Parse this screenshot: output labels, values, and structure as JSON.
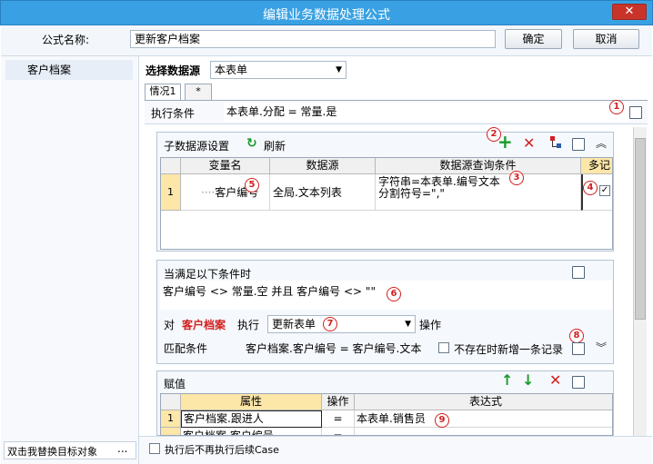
{
  "window": {
    "title": "编辑业务数据处理公式",
    "close_symbol": "✕"
  },
  "formula": {
    "name_label": "公式名称:",
    "name_value": "更新客户档案",
    "ok": "确定",
    "cancel": "取消"
  },
  "sidebar": {
    "items": [
      {
        "label": "客户档案"
      }
    ],
    "footer": "双击我替换目标对象",
    "more": "..."
  },
  "datasource": {
    "label": "选择数据源",
    "value": "本表单"
  },
  "tabs": [
    {
      "label": "情况1"
    },
    {
      "label": "*"
    }
  ],
  "condition": {
    "label": "执行条件",
    "value": "本表单.分配 = 常量.是"
  },
  "subsource": {
    "title": "子数据源设置",
    "refresh": "刷新",
    "columns": [
      "变量名",
      "数据源",
      "数据源查询条件",
      "多记"
    ],
    "rows": [
      {
        "num": "1",
        "var": "客户编号",
        "source": "全局.文本列表",
        "query": [
          "字符串=本表单.编号文本",
          "分割符号=\",\""
        ],
        "multi": true
      }
    ]
  },
  "when": {
    "title": "当满足以下条件时",
    "expr": "客户编号 <> 常量.空 并且 客户编号 <> \"\"",
    "to": "对",
    "target": "客户档案",
    "exec": "执行",
    "action": "更新表单",
    "op": "操作",
    "match_label": "匹配条件",
    "match_expr": "客户档案.客户编号 = 客户编号.文本",
    "no_exist": "不存在时新增一条记录"
  },
  "assign": {
    "title": "赋值",
    "columns": [
      "属性",
      "操作",
      "表达式"
    ],
    "rows": [
      {
        "num": "1",
        "prop": "客户档案.跟进人",
        "op": "=",
        "expr": "本表单.销售员"
      },
      {
        "num": "",
        "prop": "客户档案.客户编号",
        "op": "=",
        "expr": ""
      }
    ]
  },
  "footer": {
    "no_continue": "执行后不再执行后续Case"
  },
  "markers": [
    "1",
    "2",
    "3",
    "4",
    "5",
    "6",
    "7",
    "8",
    "9"
  ],
  "colors": {
    "title_bar": "#39a1e3",
    "target_red": "#d21f1f",
    "add_green": "#1a9a2a",
    "delete_red": "#d21f1f",
    "row_highlight": "#fce6a8"
  }
}
